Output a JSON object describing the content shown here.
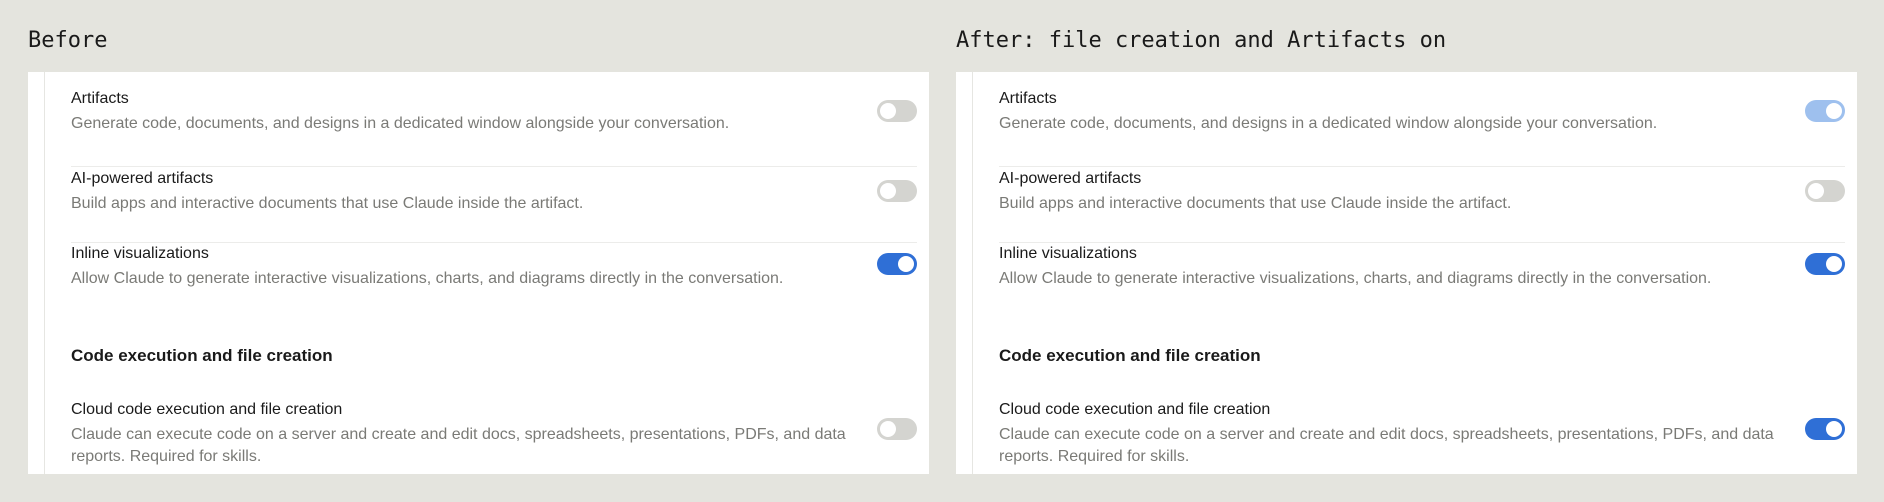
{
  "panels": [
    {
      "title": "Before",
      "rows": [
        {
          "title": "Artifacts",
          "desc": "Generate code, documents, and designs in a dedicated window alongside your conversation.",
          "toggle": "off"
        },
        {
          "title": "AI-powered artifacts",
          "desc": "Build apps and interactive documents that use Claude inside the artifact.",
          "toggle": "off"
        },
        {
          "title": "Inline visualizations",
          "desc": "Allow Claude to generate interactive visualizations, charts, and diagrams directly in the conversation.",
          "toggle": "on"
        }
      ],
      "section_heading": "Code execution and file creation",
      "code_row": {
        "title": "Cloud code execution and file creation",
        "desc": "Claude can execute code on a server and create and edit docs, spreadsheets, presentations, PDFs, and data reports. Required for skills.",
        "toggle": "off"
      }
    },
    {
      "title": "After: file creation and Artifacts on",
      "rows": [
        {
          "title": "Artifacts",
          "desc": "Generate code, documents, and designs in a dedicated window alongside your conversation.",
          "toggle": "on-light"
        },
        {
          "title": "AI-powered artifacts",
          "desc": "Build apps and interactive documents that use Claude inside the artifact.",
          "toggle": "off"
        },
        {
          "title": "Inline visualizations",
          "desc": "Allow Claude to generate interactive visualizations, charts, and diagrams directly in the conversation.",
          "toggle": "on"
        }
      ],
      "section_heading": "Code execution and file creation",
      "code_row": {
        "title": "Cloud code execution and file creation",
        "desc": "Claude can execute code on a server and create and edit docs, spreadsheets, presentations, PDFs, and data reports. Required for skills.",
        "toggle": "on"
      }
    }
  ],
  "colors": {
    "background": "#e4e4de",
    "toggle_on": "#2f6fd6",
    "toggle_on_light": "#9ec0ee",
    "toggle_off": "#d4d4d0"
  }
}
